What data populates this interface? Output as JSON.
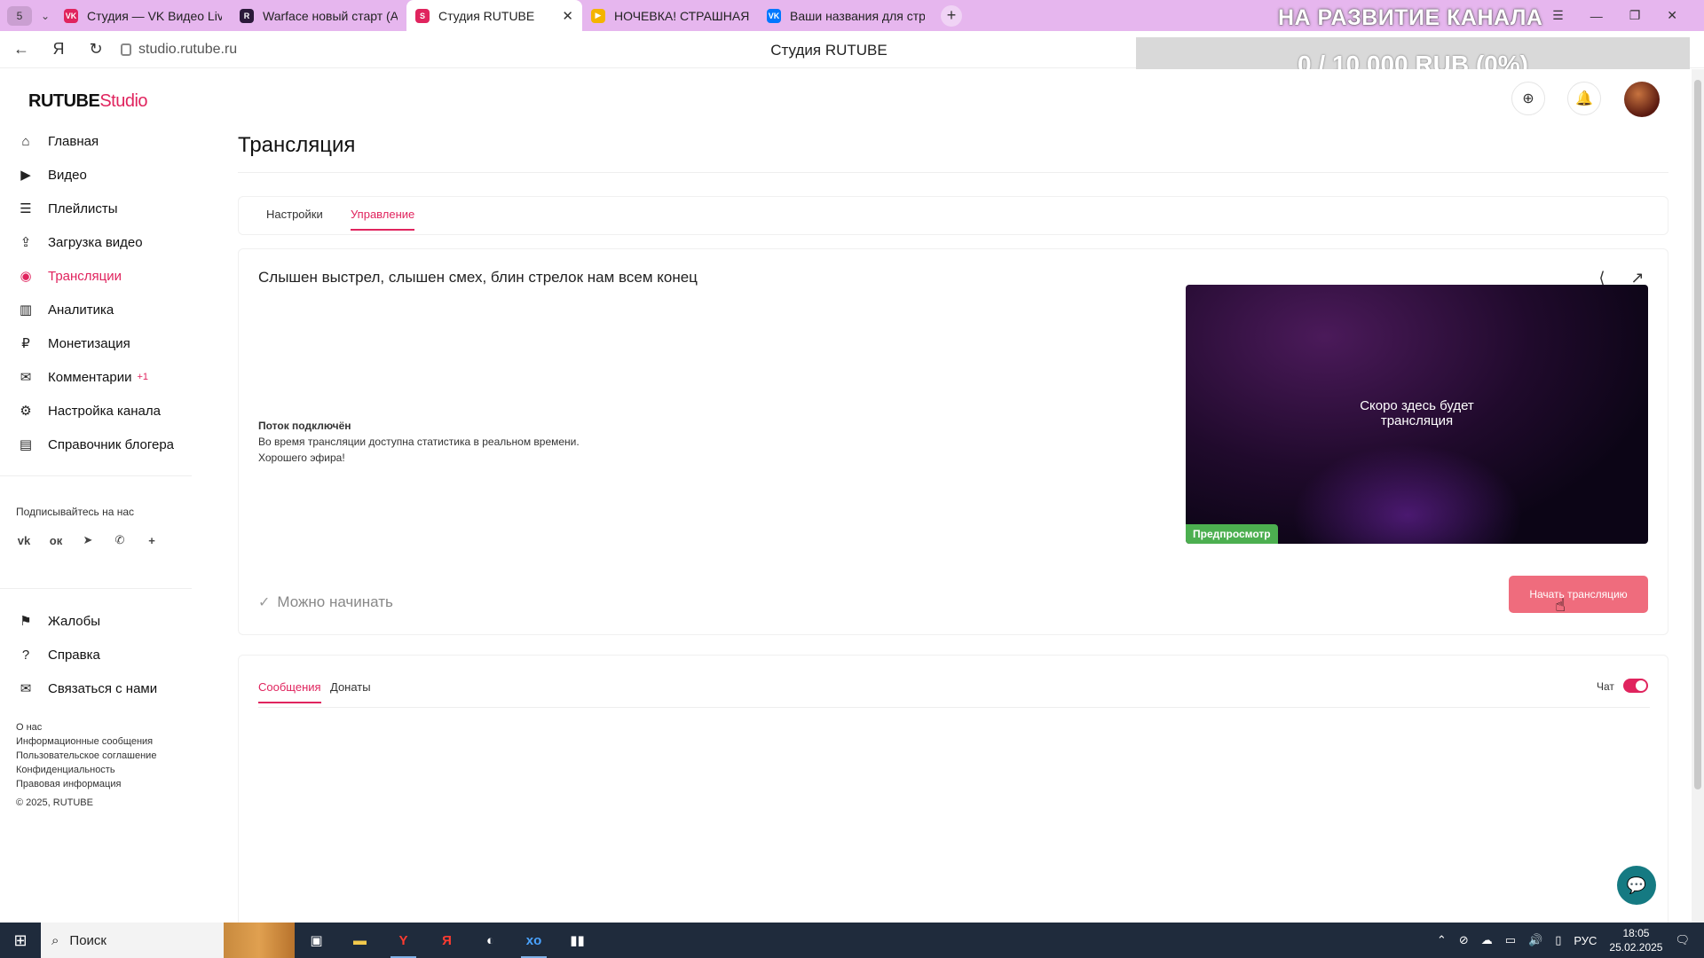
{
  "browser": {
    "tab_count": "5",
    "tabs": [
      {
        "title": "Студия — VK Видео Live",
        "fav": "VK",
        "fav_color": "#e0245e"
      },
      {
        "title": "Warface новый старт (Ad",
        "fav": "R",
        "fav_color": "#2b1a3a"
      },
      {
        "title": "Студия RUTUBE",
        "fav": "S",
        "fav_color": "#e0245e"
      },
      {
        "title": "НОЧЕВКА! СТРАШНАЯ И",
        "fav": "▶",
        "fav_color": "#f4b400"
      },
      {
        "title": "Ваши названия для стри",
        "fav": "VK",
        "fav_color": "#0077ff"
      }
    ],
    "url": "studio.rutube.ru",
    "page_title": "Студия RUTUBE"
  },
  "overlay": {
    "top_text": "НА РАЗВИТИЕ КАНАЛА",
    "goal_text": "0 / 10 000 RUB (0%)"
  },
  "logo": {
    "main": "RUTUBE",
    "sub": "Studio"
  },
  "sidebar": {
    "items": [
      {
        "label": "Главная",
        "icon": "home-icon",
        "glyph": "⌂"
      },
      {
        "label": "Видео",
        "icon": "video-icon",
        "glyph": "▶"
      },
      {
        "label": "Плейлисты",
        "icon": "playlist-icon",
        "glyph": "☰"
      },
      {
        "label": "Загрузка видео",
        "icon": "upload-icon",
        "glyph": "⇪"
      },
      {
        "label": "Трансляции",
        "icon": "broadcast-icon",
        "glyph": "◉",
        "active": true
      },
      {
        "label": "Аналитика",
        "icon": "analytics-icon",
        "glyph": "▥"
      },
      {
        "label": "Монетизация",
        "icon": "ruble-icon",
        "glyph": "₽"
      },
      {
        "label": "Комментарии",
        "icon": "comment-icon",
        "glyph": "✉",
        "badge": "+1"
      },
      {
        "label": "Настройка канала",
        "icon": "gear-icon",
        "glyph": "⚙"
      },
      {
        "label": "Справочник блогера",
        "icon": "book-icon",
        "glyph": "▤"
      }
    ],
    "follow_title": "Подписывайтесь на нас",
    "socials": [
      "vk-icon",
      "ok-icon",
      "telegram-icon",
      "viber-icon",
      "plus-icon"
    ],
    "items2": [
      {
        "label": "Жалобы",
        "icon": "flag-icon",
        "glyph": "⚑"
      },
      {
        "label": "Справка",
        "icon": "help-icon",
        "glyph": "?"
      },
      {
        "label": "Связаться с нами",
        "icon": "mail-icon",
        "glyph": "✉"
      }
    ],
    "footer_links": [
      "О нас",
      "Информационные сообщения",
      "Пользовательское соглашение",
      "Конфиденциальность",
      "Правовая информация"
    ],
    "copyright": "© 2025, RUTUBE"
  },
  "main": {
    "heading": "Трансляция",
    "tabs": [
      "Настройки",
      "Управление"
    ],
    "stream_title": "Слышен выстрел, слышен смех, блин стрелок нам всем конец",
    "status_title": "Поток подключён",
    "status_line1": "Во время трансляции доступна статистика в реальном времени.",
    "status_line2": "Хорошего эфира!",
    "preview_line1": "Скоро здесь будет",
    "preview_line2": "трансляция",
    "preview_badge": "Предпросмотр",
    "ready_text": "Можно начинать",
    "start_button": "Начать трансляцию",
    "chat_tabs": [
      "Сообщения",
      "Донаты"
    ],
    "chat_label": "Чат",
    "chat_enabled": true
  },
  "taskbar": {
    "search_placeholder": "Поиск",
    "lang": "РУС",
    "time": "18:05",
    "date": "25.02.2025"
  },
  "colors": {
    "accent": "#e0245e",
    "start_button": "#ef6c7d",
    "preview_badge": "#4caf50"
  }
}
